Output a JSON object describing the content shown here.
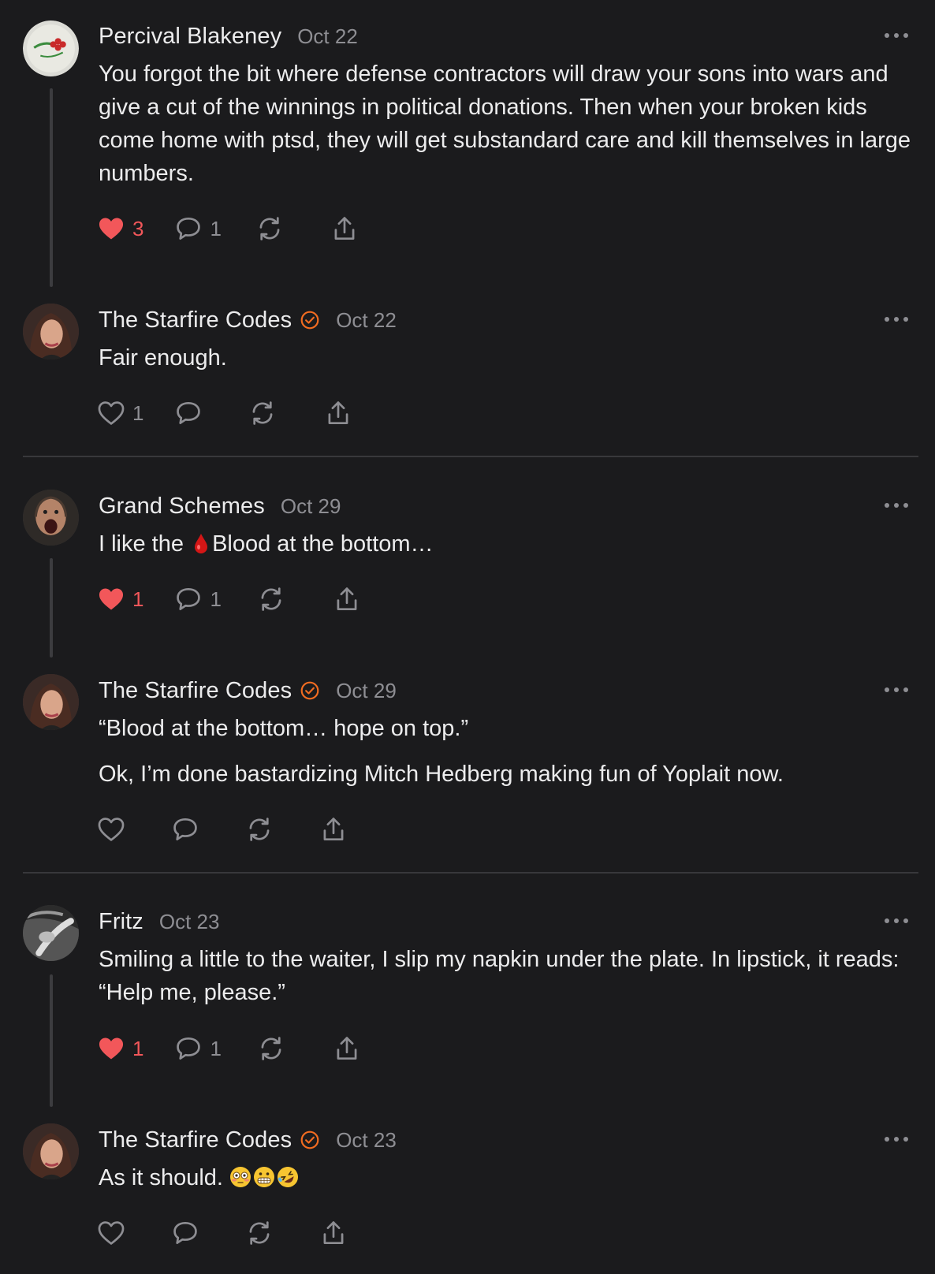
{
  "colors": {
    "accent": "#f26c21",
    "like": "#f2575a",
    "muted": "#8e8e93",
    "background": "#1b1b1d"
  },
  "comments": [
    {
      "author": "Percival Blakeney",
      "date": "Oct 22",
      "verified": false,
      "paragraphs": [
        "You forgot the bit where defense contractors will draw your sons into wars and give a cut of the winnings in political donations. Then when your broken kids come home with ptsd, they will get substandard care and kill themselves in large numbers."
      ],
      "likes": "3",
      "liked": true,
      "replies": "1"
    },
    {
      "author": "The Starfire Codes",
      "date": "Oct 22",
      "verified": true,
      "paragraphs": [
        "Fair enough."
      ],
      "likes": "1",
      "liked": false,
      "replies": ""
    },
    {
      "author": "Grand Schemes",
      "date": "Oct 29",
      "verified": false,
      "text_before": "I like the ",
      "emoji_name": "drop-of-blood-emoji",
      "text_after": "Blood at the bottom…",
      "likes": "1",
      "liked": true,
      "replies": "1"
    },
    {
      "author": "The Starfire Codes",
      "date": "Oct 29",
      "verified": true,
      "paragraphs": [
        "“Blood at the bottom… hope on top.”",
        "Ok, I’m done bastardizing Mitch Hedberg making fun of Yoplait now."
      ],
      "likes": "",
      "liked": false,
      "replies": ""
    },
    {
      "author": "Fritz",
      "date": "Oct 23",
      "verified": false,
      "paragraphs": [
        "Smiling a little to the waiter, I slip my napkin under the plate. In lipstick, it reads: “Help me, please.”"
      ],
      "likes": "1",
      "liked": true,
      "replies": "1"
    },
    {
      "author": "The Starfire Codes",
      "date": "Oct 23",
      "verified": true,
      "text_before": "As it should. ",
      "emojis": [
        "flushed-face-emoji",
        "grimacing-face-emoji",
        "rolling-on-floor-laughing-emoji"
      ],
      "likes": "",
      "liked": false,
      "replies": ""
    }
  ]
}
